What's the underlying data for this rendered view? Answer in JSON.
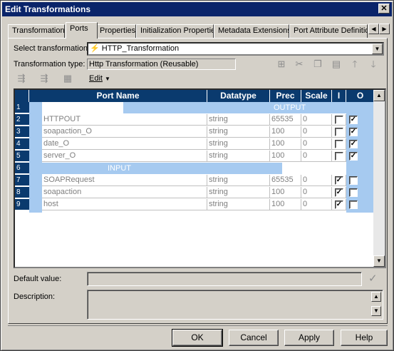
{
  "window": {
    "title": "Edit Transformations",
    "close_glyph": "✕"
  },
  "tabs": [
    {
      "label": "Transformation"
    },
    {
      "label": "Ports"
    },
    {
      "label": "Properties"
    },
    {
      "label": "Initialization Properties"
    },
    {
      "label": "Metadata Extensions"
    },
    {
      "label": "Port Attribute Definitions"
    }
  ],
  "form": {
    "select_label": "Select transformation:",
    "select_value": "HTTP_Transformation",
    "type_label": "Transformation type:",
    "type_value": "Http Transformation (Reusable)",
    "edit_menu": "Edit",
    "default_label": "Default value:",
    "description_label": "Description:"
  },
  "grid": {
    "columns": [
      "Port Name",
      "Datatype",
      "Prec",
      "Scale",
      "I",
      "O"
    ],
    "group_output": "OUTPUT",
    "group_input": "INPUT",
    "row_numbers": [
      "1",
      "2",
      "3",
      "4",
      "5",
      "6",
      "7",
      "8",
      "9"
    ],
    "rows": [
      {
        "name": "HTTPOUT",
        "datatype": "string",
        "prec": "65535",
        "scale": "0",
        "i": false,
        "o": true
      },
      {
        "name": "soapaction_O",
        "datatype": "string",
        "prec": "100",
        "scale": "0",
        "i": false,
        "o": true
      },
      {
        "name": "date_O",
        "datatype": "string",
        "prec": "100",
        "scale": "0",
        "i": false,
        "o": true
      },
      {
        "name": "server_O",
        "datatype": "string",
        "prec": "100",
        "scale": "0",
        "i": false,
        "o": true
      },
      {
        "name": "SOAPRequest",
        "datatype": "string",
        "prec": "65535",
        "scale": "0",
        "i": true,
        "o": false
      },
      {
        "name": "soapaction",
        "datatype": "string",
        "prec": "100",
        "scale": "0",
        "i": true,
        "o": false
      },
      {
        "name": "host",
        "datatype": "string",
        "prec": "100",
        "scale": "0",
        "i": true,
        "o": false
      }
    ]
  },
  "buttons": {
    "ok": "OK",
    "cancel": "Cancel",
    "apply": "Apply",
    "help": "Help"
  },
  "icons": {
    "new_port": "new-port-icon",
    "cut": "cut-icon",
    "copy": "copy-icon",
    "paste": "paste-icon",
    "move_up": "arrow-up-icon",
    "move_down": "arrow-down-icon"
  },
  "colors": {
    "header": "#0a3a6e",
    "group_band": "#a6caf0",
    "titlebar": "#0a246a"
  }
}
